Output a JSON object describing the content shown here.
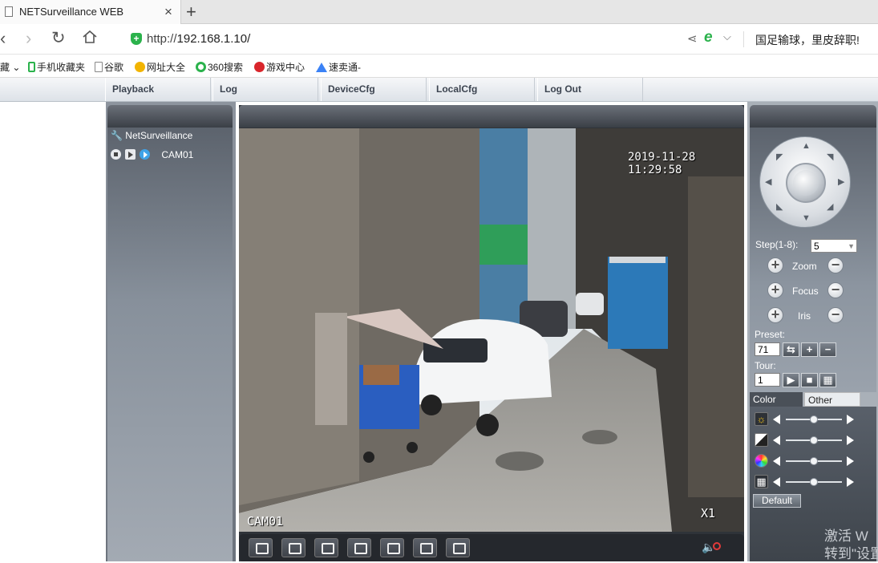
{
  "browser": {
    "tab_title": "NETSurveillance WEB",
    "tab_close": "×",
    "new_tab": "+",
    "url_scheme": "http://",
    "url_host": "192.168.1.10/",
    "news_ticker": "国足输球，里皮辞职!",
    "bookmarks": [
      {
        "label": "藏 ⌄",
        "icon": "",
        "icon_color": ""
      },
      {
        "label": "手机收藏夹",
        "icon": "phone-icon",
        "icon_color": "#2bb24c"
      },
      {
        "label": "谷歌",
        "icon": "page-icon",
        "icon_color": "#888888"
      },
      {
        "label": "网址大全",
        "icon": "smiley-icon",
        "icon_color": "#f2b400"
      },
      {
        "label": "360搜索",
        "icon": "search360-icon",
        "icon_color": "#2bb24c"
      },
      {
        "label": "游戏中心",
        "icon": "game-icon",
        "icon_color": "#d9252b"
      },
      {
        "label": "速卖通-",
        "icon": "triangle-icon",
        "icon_color": "#3b82f6"
      }
    ]
  },
  "app": {
    "menu": [
      "Playback",
      "Log",
      "DeviceCfg",
      "LocalCfg",
      "Log Out"
    ],
    "tree_root": "NetSurveillance",
    "camera_name": "CAM01",
    "video": {
      "timestamp": "2019-11-28 11:29:58",
      "channel_label": "CAM01",
      "zoom_label": "X1"
    },
    "ptz": {
      "step_label": "Step(1-8):",
      "step_value": "5",
      "zoom": "Zoom",
      "focus": "Focus",
      "iris": "Iris",
      "preset_label": "Preset:",
      "preset_value": "71",
      "tour_label": "Tour:",
      "tour_value": "1"
    },
    "color_tabs": [
      "Color",
      "Other"
    ],
    "sliders": [
      {
        "icon": "brightness-icon",
        "level": 0.5
      },
      {
        "icon": "contrast-icon",
        "level": 0.5
      },
      {
        "icon": "saturation-icon",
        "level": 0.5
      },
      {
        "icon": "hue-icon",
        "level": 0.5
      }
    ],
    "default_button": "Default"
  },
  "os_watermark": {
    "line1": "激活 W",
    "line2": "转到\"设置"
  },
  "colors": {
    "accent_green": "#2bb24c",
    "panel_dark": "#3a3f46",
    "panel_mid": "#87909b"
  }
}
